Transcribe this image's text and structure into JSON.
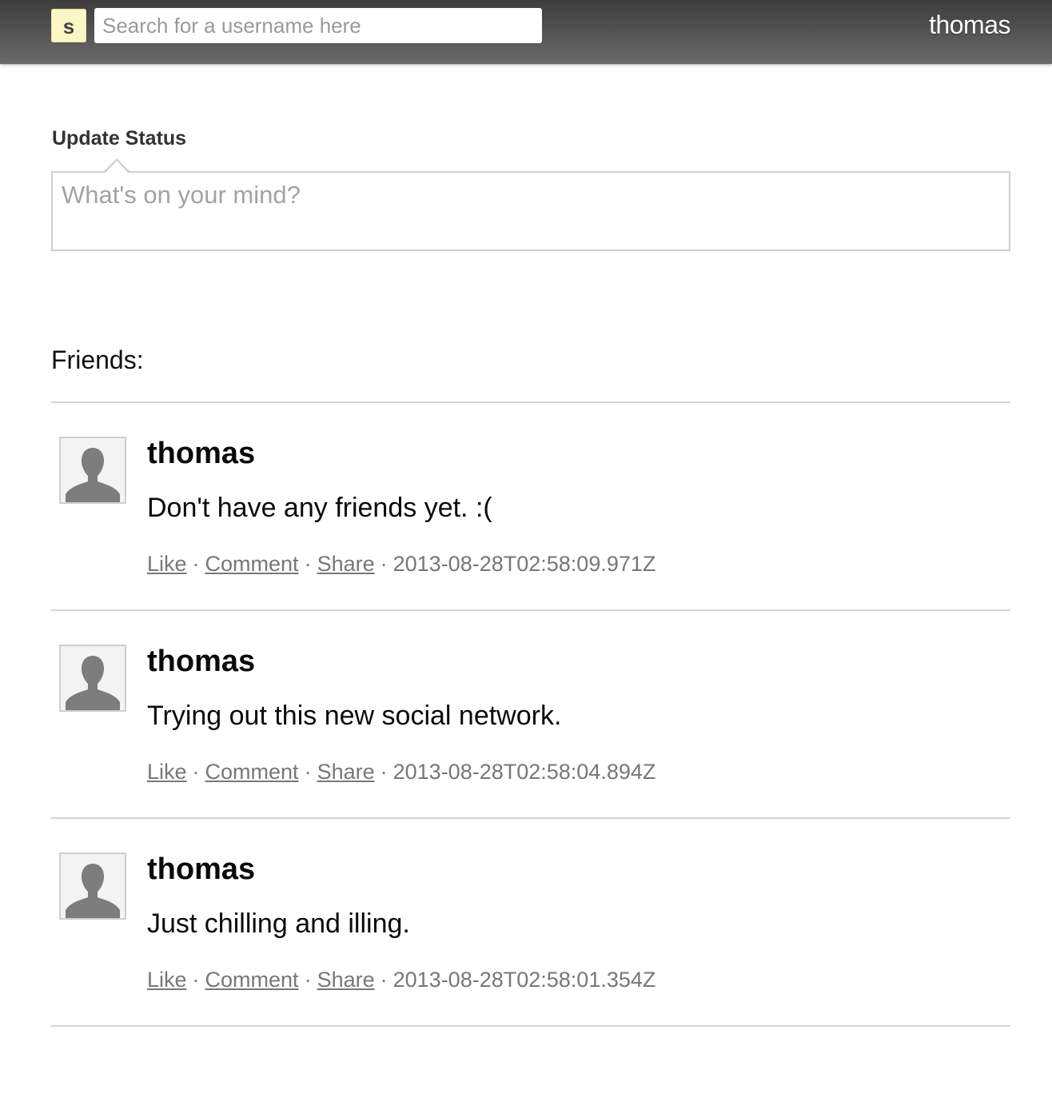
{
  "header": {
    "logo_letter": "s",
    "search_placeholder": "Search for a username here",
    "current_user": "thomas"
  },
  "composer": {
    "label": "Update Status",
    "placeholder": "What's on your mind?"
  },
  "friends": {
    "label": "Friends:"
  },
  "action_labels": {
    "like": "Like",
    "comment": "Comment",
    "share": "Share",
    "separator": "·"
  },
  "posts": [
    {
      "author": "thomas",
      "text": "Don't have any friends yet. :(",
      "timestamp": "2013-08-28T02:58:09.971Z"
    },
    {
      "author": "thomas",
      "text": "Trying out this new social network.",
      "timestamp": "2013-08-28T02:58:04.894Z"
    },
    {
      "author": "thomas",
      "text": "Just chilling and illing.",
      "timestamp": "2013-08-28T02:58:01.354Z"
    }
  ],
  "icons": {
    "avatar": "default-user-silhouette-icon"
  },
  "colors": {
    "header_bg": "#4a4a4a",
    "logo_bg": "#fbf7c4",
    "divider": "#d4d4d4",
    "meta_text": "#777777"
  }
}
